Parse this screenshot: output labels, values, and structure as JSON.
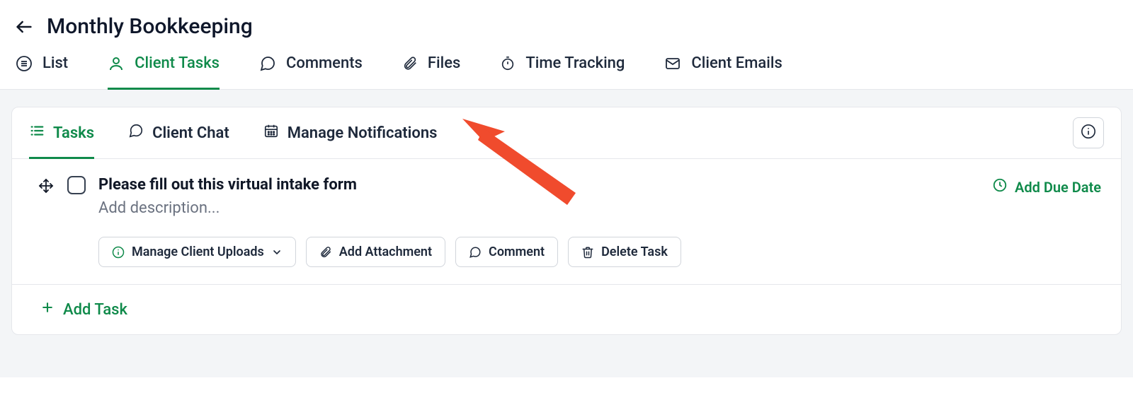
{
  "header": {
    "title": "Monthly Bookkeeping"
  },
  "main_tabs": [
    {
      "id": "list",
      "label": "List",
      "icon": "list-circle-icon"
    },
    {
      "id": "client-tasks",
      "label": "Client Tasks",
      "icon": "person-icon",
      "active": true
    },
    {
      "id": "comments",
      "label": "Comments",
      "icon": "comment-icon"
    },
    {
      "id": "files",
      "label": "Files",
      "icon": "paperclip-icon"
    },
    {
      "id": "time-tracking",
      "label": "Time Tracking",
      "icon": "stopwatch-icon"
    },
    {
      "id": "client-emails",
      "label": "Client Emails",
      "icon": "mail-icon"
    }
  ],
  "sub_tabs": [
    {
      "id": "tasks",
      "label": "Tasks",
      "icon": "list-icon",
      "active": true
    },
    {
      "id": "client-chat",
      "label": "Client Chat",
      "icon": "chat-icon"
    },
    {
      "id": "manage-notifications",
      "label": "Manage Notifications",
      "icon": "calendar-icon"
    }
  ],
  "task": {
    "title": "Please fill out this virtual intake form",
    "description_placeholder": "Add description...",
    "due_date_label": "Add Due Date",
    "buttons": {
      "manage_uploads": "Manage Client Uploads",
      "add_attachment": "Add Attachment",
      "comment": "Comment",
      "delete": "Delete Task"
    }
  },
  "add_task_label": "Add Task",
  "annotation": {
    "arrow_points_to": "manage-notifications"
  }
}
